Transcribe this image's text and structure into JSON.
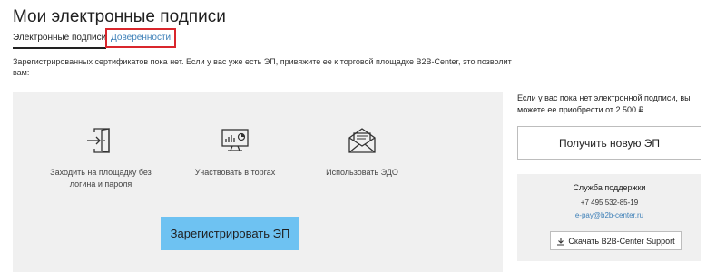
{
  "header": {
    "title": "Мои электронные подписи"
  },
  "tabs": [
    {
      "label": "Электронные подписи",
      "active": true
    },
    {
      "label": "Доверенности",
      "active": false
    }
  ],
  "notice": "Зарегистрированных сертификатов пока нет. Если у вас уже есть ЭП, привяжите ее к торговой площадке B2B-Center, это позволит вам:",
  "features": [
    {
      "icon": "login-door-icon",
      "text": "Заходить на площадку без логина и пароля"
    },
    {
      "icon": "monitor-chart-icon",
      "text": "Участвовать в торгах"
    },
    {
      "icon": "envelope-letter-icon",
      "text": "Использовать ЭДО"
    }
  ],
  "register_button": "Зарегистрировать ЭП",
  "sidebar": {
    "buy_text": "Если у вас пока нет электронной подписи, вы можете ее приобрести от 2 500 ₽",
    "new_ep_button": "Получить новую ЭП",
    "support": {
      "title": "Служба поддержки",
      "phone": "+7 495 532-85-19",
      "email": "e-pay@b2b-center.ru",
      "download_icon": "download-icon",
      "download_label": "Скачать B2B-Center Support"
    }
  },
  "colors": {
    "accent_button": "#6ec2f2",
    "link": "#3d7fb7",
    "highlight_border": "#d9262c",
    "panel_bg": "#f0f0f0"
  }
}
